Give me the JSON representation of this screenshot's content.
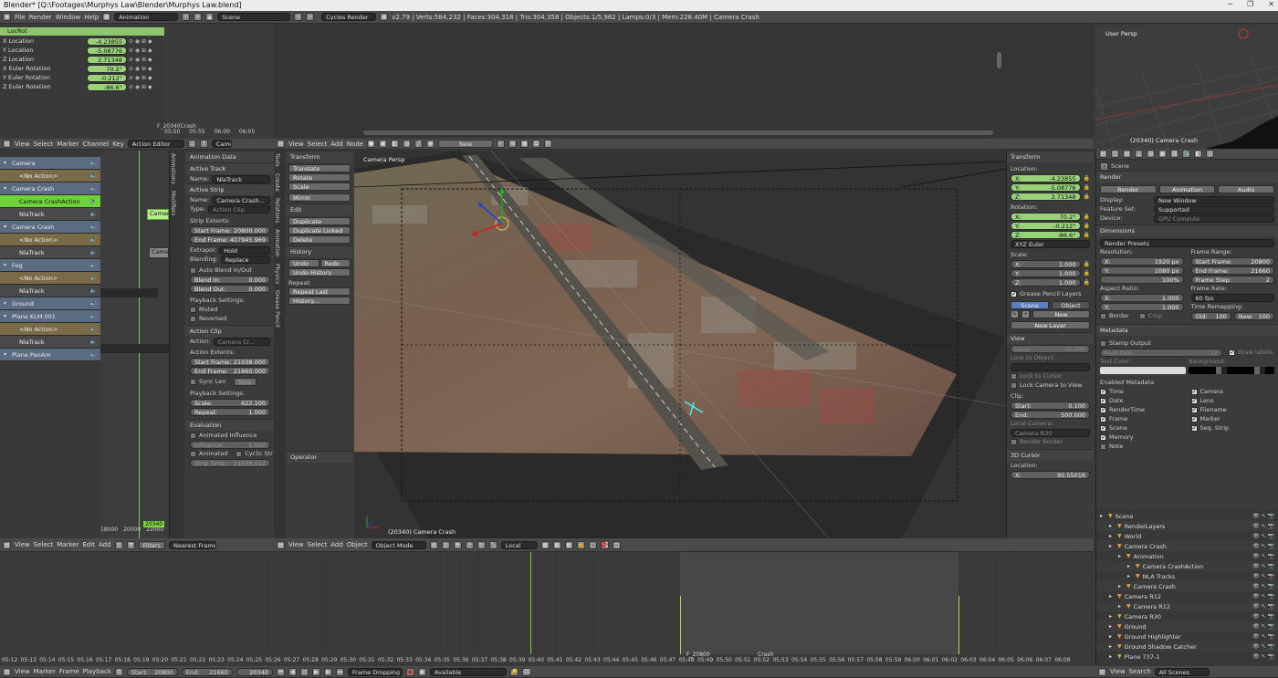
{
  "window": {
    "title": "Blender* [Q:\\Footages\\Murphys Law\\Blender\\Murphys Law.blend]",
    "minimize": "─",
    "maximize": "❐",
    "close": "✕"
  },
  "topbar": {
    "menus": [
      "File",
      "Render",
      "Window",
      "Help"
    ],
    "layout": "Animation",
    "scene": "Scene",
    "engine": "Cycles Render",
    "stats": "v2.79 | Verts:584,232 | Faces:304,318 | Tris:304,358 | Objects:1/5,962 | Lamps:0/3 | Mem:228.40M | Camera Crash"
  },
  "graph": {
    "header": "LocRot",
    "channels": [
      {
        "label": "X Location",
        "value": "-4.23855"
      },
      {
        "label": "Y Location",
        "value": "-5.08776"
      },
      {
        "label": "Z Location",
        "value": "2.71348"
      },
      {
        "label": "X Euler Rotation",
        "value": "70.2°"
      },
      {
        "label": "Y Euler Rotation",
        "value": "-0.212°"
      },
      {
        "label": "Z Euler Rotation",
        "value": "-86.6°"
      }
    ],
    "marker": "F_20340Crash",
    "ticks": [
      "05:50",
      "05:55",
      "06:00",
      "06:05"
    ]
  },
  "action_editor": {
    "menus": [
      "View",
      "Select",
      "Marker",
      "Channel",
      "Key"
    ],
    "mode": "Action Editor",
    "camera_field": "Camer"
  },
  "node_editor": {
    "menus": [
      "View",
      "Select",
      "Add",
      "Node"
    ],
    "new_button": "New"
  },
  "nla": {
    "rows": [
      {
        "label": "Camera",
        "type": "obj"
      },
      {
        "label": "<No Action>",
        "type": "noact"
      },
      {
        "label": "Camera Crash",
        "type": "obj"
      },
      {
        "label": "Camera CrashAction",
        "type": "active"
      },
      {
        "label": "NlaTrack",
        "type": "track"
      },
      {
        "label": "Camera Crash",
        "type": "obj2"
      },
      {
        "label": "<No Action>",
        "type": "noact"
      },
      {
        "label": "NlaTrack",
        "type": "track"
      },
      {
        "label": "Fog",
        "type": "obj"
      },
      {
        "label": "<No Action>",
        "type": "noact"
      },
      {
        "label": "NlaTrack",
        "type": "track"
      },
      {
        "label": "Ground",
        "type": "obj"
      },
      {
        "label": "Plane KLM.001",
        "type": "obj"
      },
      {
        "label": "<No Action>",
        "type": "noact"
      },
      {
        "label": "NlaTrack",
        "type": "track"
      },
      {
        "label": "Plane PanAm",
        "type": "obj"
      }
    ],
    "strip1": "Camer",
    "strip2": "Came",
    "ruler": [
      "18000",
      "20000",
      "22000"
    ],
    "frame_marker": "20340",
    "menus": [
      "View",
      "Select",
      "Marker",
      "Edit",
      "Add"
    ],
    "filters": "Filters",
    "nearest": "Nearest Frame"
  },
  "nla_props": {
    "tabs": [
      "Animations",
      "Modifiers"
    ],
    "animation_data": "Animation Data",
    "active_track": "Active Track",
    "name_label": "Name:",
    "track_name": "NlaTrack",
    "active_strip": "Active Strip",
    "strip_name": "Camera Crash...",
    "type_label": "Type:",
    "type_value": "Action Clip",
    "strip_extents": "Strip Extents:",
    "start_frame": {
      "label": "Start Frame:",
      "value": "20800.000"
    },
    "end_frame": {
      "label": "End Frame:",
      "value": "407945.969"
    },
    "extrapol": {
      "label": "Extrapol:",
      "value": "Hold"
    },
    "blending": {
      "label": "Blending:",
      "value": "Replace"
    },
    "auto_blend": "Auto Blend In/Out",
    "blend_in": {
      "label": "Blend In:",
      "value": "0.000"
    },
    "blend_out": {
      "label": "Blend Out:",
      "value": "0.000"
    },
    "playback": "Playback Settings:",
    "muted": "Muted",
    "reversed": "Reversed",
    "action_clip": "Action Clip",
    "action_label": "Action:",
    "action_value": "Camera Cr...",
    "action_extents": "Action Extents:",
    "a_start": {
      "label": "Start Frame:",
      "value": "21038.000"
    },
    "a_end": {
      "label": "End Frame:",
      "value": "21660.000"
    },
    "sync_len": "Sync Len",
    "now": "Now",
    "playback2": "Playback Settings:",
    "scale": {
      "label": "Scale:",
      "value": "622.100"
    },
    "repeat": {
      "label": "Repeat:",
      "value": "1.000"
    },
    "evaluation": "Evaluation",
    "animated_influence": "Animated Influence",
    "influence": {
      "label": "Influence:",
      "value": "1.000"
    },
    "animated": "Animated",
    "cyclic": "Cyclic Str",
    "strip_time": {
      "label": "Strip Time:",
      "value": "21038.012"
    }
  },
  "tool_shelf": {
    "tabs": [
      "Tools",
      "Create",
      "Relations",
      "Animation",
      "Physics",
      "Grease Pencil"
    ],
    "transform": "Transform",
    "translate": "Translate",
    "rotate": "Rotate",
    "scale": "Scale",
    "mirror": "Mirror",
    "edit": "Edit",
    "duplicate": "Duplicate",
    "duplicate_linked": "Duplicate Linked",
    "delete": "Delete",
    "history": "History",
    "undo": "Undo",
    "redo": "Redo",
    "undo_history": "Undo History",
    "repeat": "Repeat:",
    "repeat_last": "Repeat Last",
    "history_btn": "History...",
    "operator": "Operator"
  },
  "viewport": {
    "label": "Camera Persp",
    "status": "(20340) Camera Crash",
    "menus": [
      "View",
      "Select",
      "Add",
      "Object"
    ],
    "mode": "Object Mode",
    "orientation": "Local"
  },
  "n_panel": {
    "transform": "Transform",
    "location": "Location:",
    "loc": [
      {
        "axis": "X:",
        "value": "-4.23855"
      },
      {
        "axis": "Y:",
        "value": "-5.08776"
      },
      {
        "axis": "Z:",
        "value": "2.71348"
      }
    ],
    "rotation": "Rotation:",
    "rot": [
      {
        "axis": "X:",
        "value": "70.2°"
      },
      {
        "axis": "Y:",
        "value": "-0.212°"
      },
      {
        "axis": "Z:",
        "value": "-86.6°"
      }
    ],
    "euler": "XYZ Euler",
    "scale": "Scale:",
    "scl": [
      {
        "axis": "X:",
        "value": "1.000"
      },
      {
        "axis": "Y:",
        "value": "1.000"
      },
      {
        "axis": "Z:",
        "value": "1.000"
      }
    ],
    "gp_layers": "Grease Pencil Layers",
    "scene_tab": "Scene",
    "object_tab": "Object",
    "new": "New",
    "new_layer": "New Layer",
    "view": "View",
    "lens": {
      "label": "Lens:",
      "value": "35.000"
    },
    "lock_obj": "Lock to Object:",
    "lock_cursor": "Lock to Cursor",
    "lock_camera": "Lock Camera to View",
    "clip": "Clip:",
    "clip_start": {
      "label": "Start:",
      "value": "0.100"
    },
    "clip_end": {
      "label": "End:",
      "value": "500.000"
    },
    "local_camera": "Local Camera:",
    "local_camera_value": "Camera R30",
    "render_border": "Render Border",
    "cursor": "3D Cursor",
    "cursor_loc": "Location:",
    "cursor_x": {
      "label": "X:",
      "value": "90.55016"
    }
  },
  "mini_view": {
    "label": "User Persp",
    "status": "(20340) Camera Crash"
  },
  "properties": {
    "scene": "Scene",
    "render": "Render",
    "render_btn": "Render",
    "animation_btn": "Animation",
    "audio_btn": "Audio",
    "display": {
      "label": "Display:",
      "value": "New Window"
    },
    "feature_set": {
      "label": "Feature Set:",
      "value": "Supported"
    },
    "device": {
      "label": "Device:",
      "value": "GPU Compute"
    },
    "dimensions": "Dimensions",
    "presets": "Render Presets",
    "resolution": "Resolution:",
    "res_x": {
      "label": "X:",
      "value": "1920 px"
    },
    "res_y": {
      "label": "Y:",
      "value": "1080 px"
    },
    "res_pct": "100%",
    "frame_range": "Frame Range:",
    "fr_start": {
      "label": "Start Frame:",
      "value": "20800"
    },
    "fr_end": {
      "label": "End Frame:",
      "value": "21660"
    },
    "fr_step": {
      "label": "Frame Step:",
      "value": "2"
    },
    "aspect": "Aspect Ratio:",
    "asp_x": {
      "label": "X:",
      "value": "1.000"
    },
    "asp_y": {
      "label": "Y:",
      "value": "1.000"
    },
    "frame_rate": "Frame Rate:",
    "fps": "60 fps",
    "time_remap": "Time Remapping:",
    "old": {
      "label": "Old:",
      "value": "100"
    },
    "new": {
      "label": "New:",
      "value": "100"
    },
    "border": "Border",
    "crop": "Crop",
    "metadata": "Metadata",
    "stamp": "Stamp Output",
    "font_size": {
      "label": "Font Size:",
      "value": "12"
    },
    "draw_labels": "Draw labels",
    "text_color": "Text Color:",
    "background": "Background:",
    "enabled_meta": "Enabled Metadata",
    "meta_left": [
      "Time",
      "Date",
      "RenderTime",
      "Frame",
      "Scene",
      "Memory"
    ],
    "meta_right": [
      "Camera",
      "Lens",
      "Filename",
      "Marker",
      "Seq. Strip"
    ],
    "note": "Note"
  },
  "outliner": {
    "items": [
      {
        "label": "Scene",
        "indent": 0
      },
      {
        "label": "RenderLayers",
        "indent": 1
      },
      {
        "label": "World",
        "indent": 1
      },
      {
        "label": "Camera Crash",
        "indent": 1
      },
      {
        "label": "Animation",
        "indent": 2
      },
      {
        "label": "Camera CrashAction",
        "indent": 3
      },
      {
        "label": "NLA Tracks",
        "indent": 3
      },
      {
        "label": "Camera Crash",
        "indent": 2
      },
      {
        "label": "Camera R12",
        "indent": 1
      },
      {
        "label": "Camera R12",
        "indent": 2
      },
      {
        "label": "Camera R30",
        "indent": 1
      },
      {
        "label": "Ground",
        "indent": 1
      },
      {
        "label": "Ground Highlighter",
        "indent": 1
      },
      {
        "label": "Ground Shadow Catcher",
        "indent": 1
      },
      {
        "label": "Plane 737-1",
        "indent": 1
      }
    ],
    "menus": [
      "View",
      "Search"
    ],
    "filter": "All Scenes"
  },
  "timeline": {
    "ticks": [
      "05:12",
      "05:13",
      "05:14",
      "05:15",
      "05:16",
      "05:17",
      "05:18",
      "05:19",
      "05:20",
      "05:21",
      "05:22",
      "05:23",
      "05:24",
      "05:25",
      "05:26",
      "05:27",
      "05:28",
      "05:29",
      "05:30",
      "05:31",
      "05:32",
      "05:33",
      "05:34",
      "05:35",
      "05:36",
      "05:37",
      "05:38",
      "05:39",
      "05:40",
      "05:41",
      "05:42",
      "05:43",
      "05:44",
      "05:45",
      "05:46",
      "05:47",
      "05:48",
      "05:49",
      "05:50",
      "05:51",
      "05:52",
      "05:53",
      "05:54",
      "05:55",
      "05:56",
      "05:57",
      "05:58",
      "05:59",
      "06:00",
      "06:01",
      "06:02",
      "06:03",
      "06:04",
      "06:05",
      "06:06",
      "06:07",
      "06:08"
    ],
    "marker1": "F_20800",
    "marker2": "Crash",
    "menus": [
      "View",
      "Marker",
      "Frame",
      "Playback"
    ],
    "start": {
      "label": "Start:",
      "value": "20800"
    },
    "end": {
      "label": "End:",
      "value": "21660"
    },
    "current": "20340",
    "sync": "Frame Dropping",
    "keying": "Available"
  }
}
